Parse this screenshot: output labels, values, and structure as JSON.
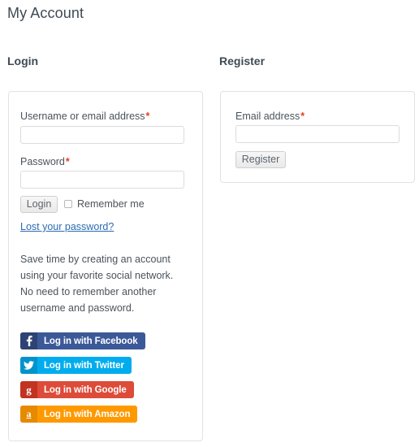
{
  "page": {
    "title": "My Account"
  },
  "login": {
    "heading": "Login",
    "username": {
      "label": "Username or email address",
      "required_mark": "*",
      "value": "",
      "placeholder": ""
    },
    "password": {
      "label": "Password",
      "required_mark": "*",
      "value": "",
      "placeholder": ""
    },
    "submit_label": "Login",
    "remember_label": "Remember me",
    "remember_checked": false,
    "lost_password_label": "Lost your password?",
    "promo_text": "Save time by creating an account using your favorite social network. No need to remember another username and password.",
    "social_buttons": [
      {
        "name": "facebook",
        "label": "Log in with Facebook",
        "icon": "facebook-icon",
        "glyph": "f",
        "body_color": "#3b5998",
        "icon_color": "#2d4373"
      },
      {
        "name": "twitter",
        "label": "Log in with Twitter",
        "icon": "twitter-icon",
        "glyph": "",
        "body_color": "#00acee",
        "icon_color": "#0093cc"
      },
      {
        "name": "google",
        "label": "Log in with Google",
        "icon": "google-icon",
        "glyph": "g",
        "body_color": "#dd4b39",
        "icon_color": "#c23321"
      },
      {
        "name": "amazon",
        "label": "Log in with Amazon",
        "icon": "amazon-icon",
        "glyph": "a",
        "body_color": "#ff9900",
        "icon_color": "#e68a00"
      }
    ]
  },
  "register": {
    "heading": "Register",
    "email": {
      "label": "Email address",
      "required_mark": "*",
      "value": "",
      "placeholder": ""
    },
    "submit_label": "Register"
  },
  "colors": {
    "required": "#e2401c",
    "link": "#2b6cb0",
    "text": "#4a545c",
    "panel_border": "#e2e2e2"
  }
}
